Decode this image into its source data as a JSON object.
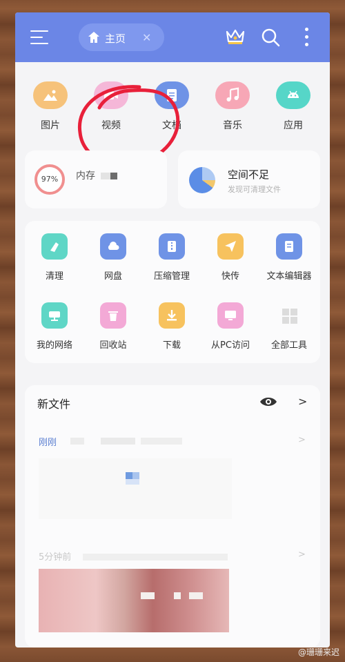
{
  "header": {
    "tab_label": "主页",
    "icons": [
      "menu-icon",
      "home-icon",
      "close-icon",
      "crown-icon",
      "search-icon",
      "more-vertical-icon"
    ]
  },
  "categories": [
    {
      "label": "图片",
      "icon": "image-icon",
      "color": "#f6c27a"
    },
    {
      "label": "视频",
      "icon": "video-icon",
      "color": "#f5b7d8"
    },
    {
      "label": "文档",
      "icon": "document-icon",
      "color": "#6f93e6"
    },
    {
      "label": "音乐",
      "icon": "music-icon",
      "color": "#f7a7b6"
    },
    {
      "label": "应用",
      "icon": "android-icon",
      "color": "#56d6c8"
    }
  ],
  "storage": {
    "memory_percent_text": "97%",
    "memory_label": "内存",
    "space_title": "空间不足",
    "space_subtitle": "发现可清理文件"
  },
  "tools": [
    {
      "label": "清理",
      "icon": "broom-icon",
      "color": "#5fd6c6"
    },
    {
      "label": "网盘",
      "icon": "cloud-drive-icon",
      "color": "#6f93e6"
    },
    {
      "label": "压缩管理",
      "icon": "zip-icon",
      "color": "#6f93e6"
    },
    {
      "label": "快传",
      "icon": "send-icon",
      "color": "#f7c25e"
    },
    {
      "label": "文本编辑器",
      "icon": "text-editor-icon",
      "color": "#6f93e6"
    },
    {
      "label": "我的网络",
      "icon": "network-icon",
      "color": "#5fd6c6"
    },
    {
      "label": "回收站",
      "icon": "trash-icon",
      "color": "#f3a9d6"
    },
    {
      "label": "下载",
      "icon": "download-icon",
      "color": "#f7c25e"
    },
    {
      "label": "从PC访问",
      "icon": "pc-access-icon",
      "color": "#f3a9d6"
    },
    {
      "label": "全部工具",
      "icon": "grid-icon",
      "color": "#dcdcdc"
    }
  ],
  "new_files": {
    "title": "新文件",
    "group1_time": "刚刚",
    "group2_time": "5分钟前"
  },
  "watermark": "@珊珊来迟",
  "colors": {
    "header": "#6b86e6",
    "annotation": "#e8203a"
  }
}
